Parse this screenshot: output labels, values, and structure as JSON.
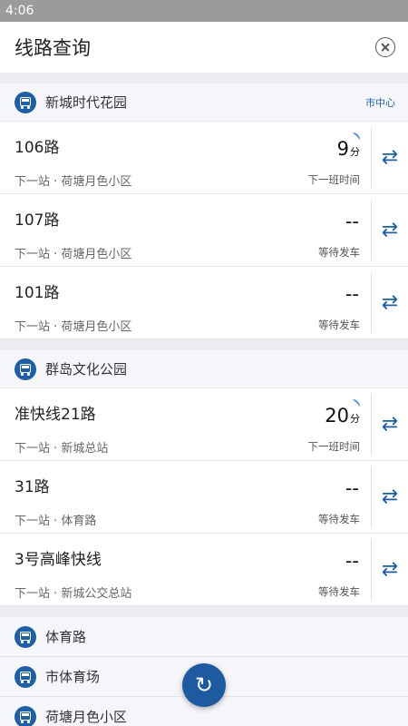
{
  "status_bar": {
    "time": "4:06"
  },
  "header": {
    "title": "线路查询"
  },
  "groups": [
    {
      "stop_name": "新城时代花园",
      "tag": "市中心",
      "routes": [
        {
          "name": "106路",
          "next_stop": "下一站 · 荷塘月色小区",
          "arrival": "9",
          "unit": "分",
          "status": "下一班时间"
        },
        {
          "name": "107路",
          "next_stop": "下一站 · 荷塘月色小区",
          "arrival": "--",
          "unit": "",
          "status": "等待发车"
        },
        {
          "name": "101路",
          "next_stop": "下一站 · 荷塘月色小区",
          "arrival": "--",
          "unit": "",
          "status": "等待发车"
        }
      ]
    },
    {
      "stop_name": "群岛文化公园",
      "tag": "",
      "routes": [
        {
          "name": "准快线21路",
          "next_stop": "下一站 · 新城总站",
          "arrival": "20",
          "unit": "分",
          "status": "下一班时间"
        },
        {
          "name": "31路",
          "next_stop": "下一站 · 体育路",
          "arrival": "--",
          "unit": "",
          "status": "等待发车"
        },
        {
          "name": "3号高峰快线",
          "next_stop": "下一站 · 新城公交总站",
          "arrival": "--",
          "unit": "",
          "status": "等待发车"
        }
      ]
    }
  ],
  "more_stops": [
    {
      "name": "体育路"
    },
    {
      "name": "市体育场"
    },
    {
      "name": "荷塘月色小区"
    }
  ],
  "icons": {
    "swap": "swap-arrows-icon",
    "refresh": "refresh-icon",
    "bus": "bus-stop-icon",
    "close": "close-icon"
  },
  "colors": {
    "accent": "#1f5fa6",
    "status_bar": "#9b9b9b"
  }
}
